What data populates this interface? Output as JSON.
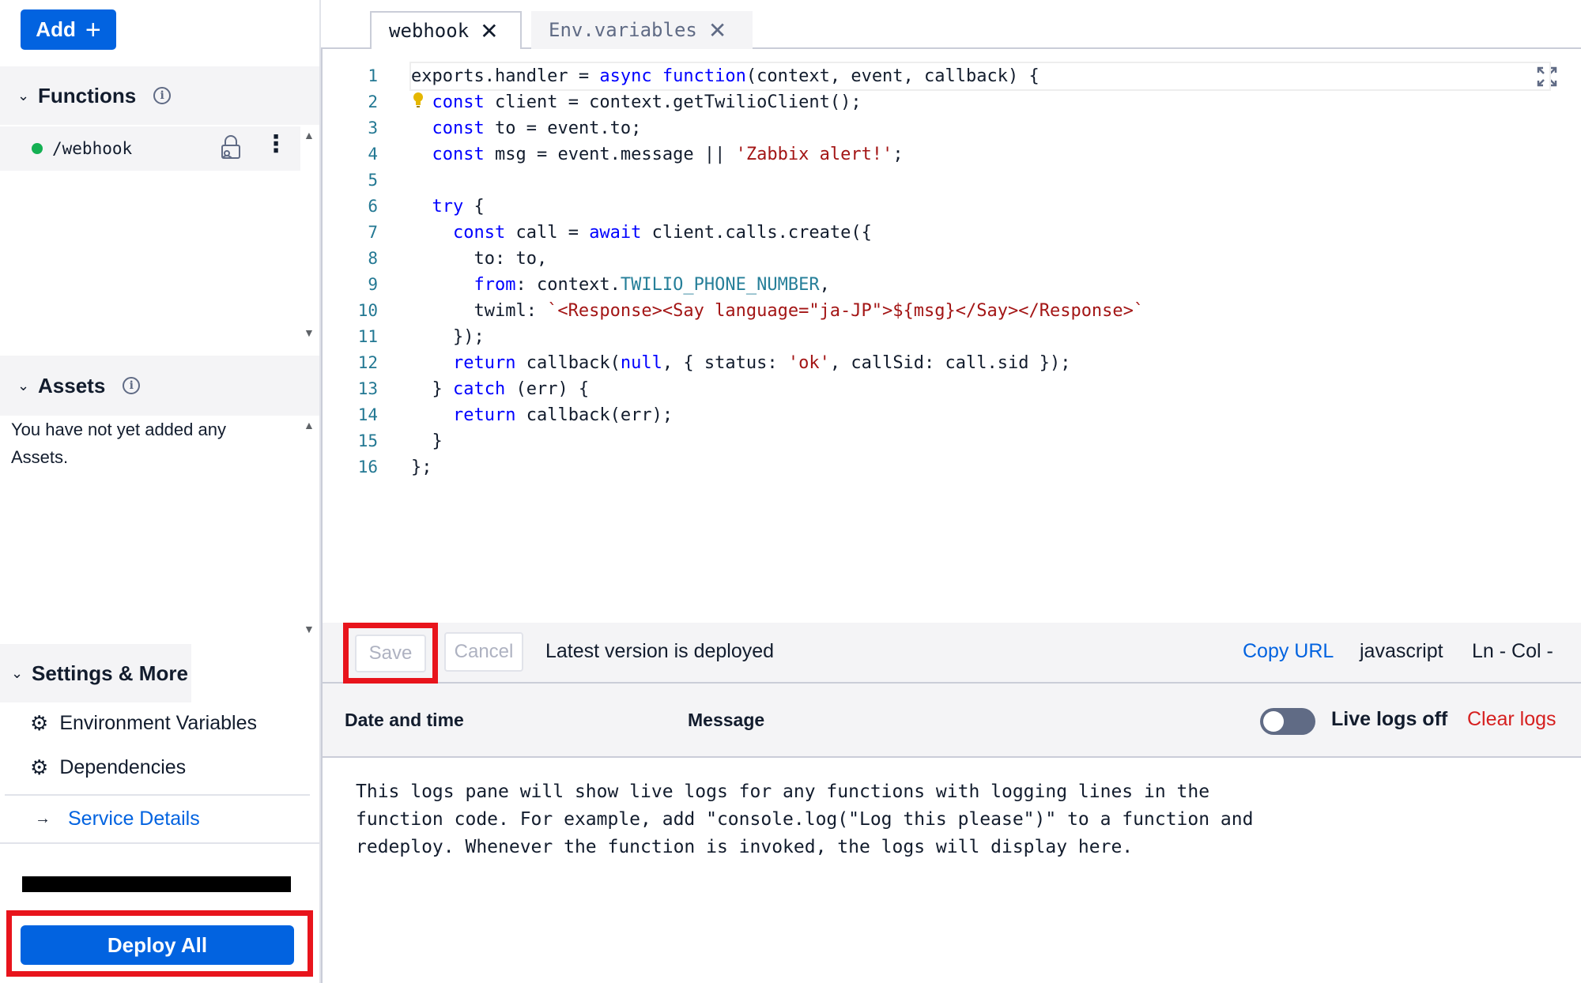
{
  "sidebar": {
    "add_label": "Add",
    "functions": {
      "title": "Functions",
      "items": [
        {
          "path": "/webhook",
          "status_color": "#14b053"
        }
      ]
    },
    "assets": {
      "title": "Assets",
      "empty_text": "You have not yet added any Assets."
    },
    "settings": {
      "title": "Settings & More",
      "links": [
        {
          "label": "Environment Variables",
          "icon": "gear-icon"
        },
        {
          "label": "Dependencies",
          "icon": "gear-icon"
        }
      ],
      "service_details": "Service Details"
    },
    "deploy_label": "Deploy All"
  },
  "tabs": [
    {
      "label": "webhook",
      "active": true
    },
    {
      "label": "Env.variables",
      "active": false
    }
  ],
  "editor": {
    "line_numbers": [
      "1",
      "2",
      "3",
      "4",
      "5",
      "6",
      "7",
      "8",
      "9",
      "10",
      "11",
      "12",
      "13",
      "14",
      "15",
      "16"
    ],
    "code_lines": [
      "exports.handler = async function(context, event, callback) {",
      "  const client = context.getTwilioClient();",
      "  const to = event.to;",
      "  const msg = event.message || 'Zabbix alert!';",
      "",
      "  try {",
      "    const call = await client.calls.create({",
      "      to: to,",
      "      from: context.TWILIO_PHONE_NUMBER,",
      "      twiml: `<Response><Say language=\"ja-JP\">${msg}</Say></Response>`",
      "    });",
      "    return callback(null, { status: 'ok', callSid: call.sid });",
      "  } catch (err) {",
      "    return callback(err);",
      "  }",
      "};"
    ]
  },
  "toolbar": {
    "save_label": "Save",
    "cancel_label": "Cancel",
    "status": "Latest version is deployed",
    "copy_url": "Copy URL",
    "language": "javascript",
    "cursor": "Ln -  Col -"
  },
  "logs": {
    "col_date": "Date and time",
    "col_message": "Message",
    "live_label": "Live logs off",
    "clear_label": "Clear logs",
    "body": "This logs pane will show live logs for any functions with logging lines in the function code. For example, add \"console.log(\"Log this please\")\" to a function and redeploy. Whenever the function is invoked, the logs will display here."
  },
  "colors": {
    "primary": "#0263e0",
    "highlight_frame": "#e8141c",
    "clear_logs": "#d61f1f",
    "status_dot": "#14b053"
  }
}
